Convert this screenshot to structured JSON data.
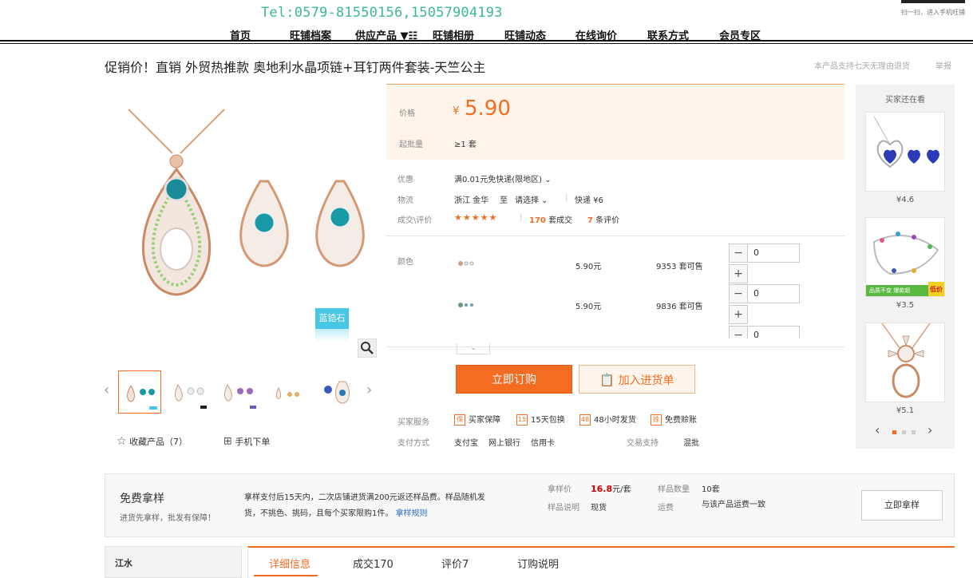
{
  "header": {
    "tel": "Tel:0579-81550156,15057904193",
    "qr_text": "扫一扫，进入手机旺铺",
    "nav": [
      "首页",
      "旺铺档案",
      "供应产品 ▼☷",
      "旺铺相册",
      "旺铺动态",
      "在线询价",
      "联系方式",
      "会员专区"
    ]
  },
  "product": {
    "title": "促销价！直销 外贸热推款 奥地利水晶项链+耳钉两件套装-天竺公主",
    "return_note": "本产品支持七天无理由退货",
    "report": "举报",
    "badge": "蓝锆石",
    "collect_label": "收藏产品（7）",
    "mobile_label": "手机下单"
  },
  "price": {
    "price_label": "价格",
    "currency": "¥",
    "value": "5.90",
    "moq_label": "起批量",
    "moq_value": "≥1 套"
  },
  "info": {
    "discount_label": "优惠",
    "discount_value": "满0.01元免快递(限地区) ⌄",
    "logistics_label": "物流",
    "from": "浙江 金华",
    "to_label": "至",
    "to_value": "请选择 ⌄",
    "express": "快递 ¥6",
    "deal_label": "成交\\评价",
    "stars": "★★★★★",
    "sold_count": "170",
    "sold_suffix": "套成交",
    "review_count": "7",
    "review_suffix": "条评价"
  },
  "sku": {
    "label": "颜色",
    "rows": [
      {
        "price": "5.90元",
        "stock": "9353 套可售",
        "qty": "0"
      },
      {
        "price": "5.90元",
        "stock": "9836 套可售",
        "qty": "0"
      },
      {
        "qty": "0"
      }
    ]
  },
  "actions": {
    "buy": "立即订购",
    "cart": "加入进货单"
  },
  "services": {
    "label": "买家服务",
    "items": [
      "买家保障",
      "15天包换",
      "48小时发货",
      "免费赊账"
    ],
    "pay_label": "支付方式",
    "pay_methods": [
      "支付宝",
      "网上银行",
      "信用卡"
    ],
    "trade_label": "交易支持",
    "trade_value": "混批"
  },
  "sidebar": {
    "title": "买家还在看",
    "items": [
      {
        "price": "¥4.6"
      },
      {
        "price": "¥3.5"
      },
      {
        "price": "¥5.1"
      }
    ],
    "banner_left": "品质不变 爆款超",
    "banner_right": "低价"
  },
  "sample": {
    "title": "免费拿样",
    "sub": "进货先拿样，批发有保障！",
    "desc": "拿样支付后15天内，二次店铺进货满200元返还样品费。样品随机发货，不挑色、挑码，且每个买家限购1件。",
    "rule_link": "拿样规则",
    "price_label": "拿样价",
    "price_value": "16.8",
    "price_unit": "元/套",
    "qty_label": "样品数量",
    "qty_value": "10套",
    "desc_label": "样品说明",
    "desc_value": "现货",
    "ship_label": "运费",
    "ship_value": "与该产品运费一致",
    "button": "立即拿样"
  },
  "shop": {
    "name": "江水"
  },
  "tabs": [
    "详细信息",
    "成交170",
    "评价7",
    "订购说明"
  ]
}
